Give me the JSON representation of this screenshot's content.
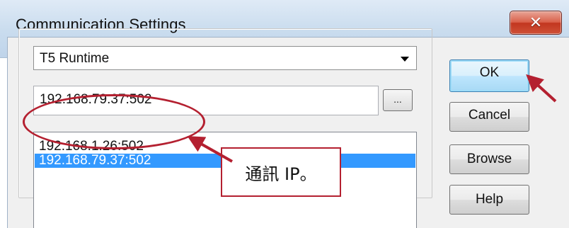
{
  "window": {
    "title": "Communication Settings",
    "close_glyph": "✕",
    "close_icon": "close-icon",
    "colors": {
      "title_bg": "#c9dcee",
      "close_bg": "#c2361f",
      "selection": "#3399ff",
      "annotation": "#b42030"
    }
  },
  "dropdown": {
    "selected": "T5 Runtime",
    "arrow_icon": "dropdown-arrow-icon"
  },
  "address": {
    "value": "192.168.79.37:502"
  },
  "browse_dots": {
    "label": "..."
  },
  "list": {
    "items": [
      {
        "label": "192.168.1.26:502",
        "selected": false
      },
      {
        "label": "192.168.79.37:502",
        "selected": true
      }
    ]
  },
  "buttons": {
    "ok": "OK",
    "cancel": "Cancel",
    "browse": "Browse",
    "help": "Help"
  },
  "annotation": {
    "callout_text": "通訊 IP。"
  }
}
